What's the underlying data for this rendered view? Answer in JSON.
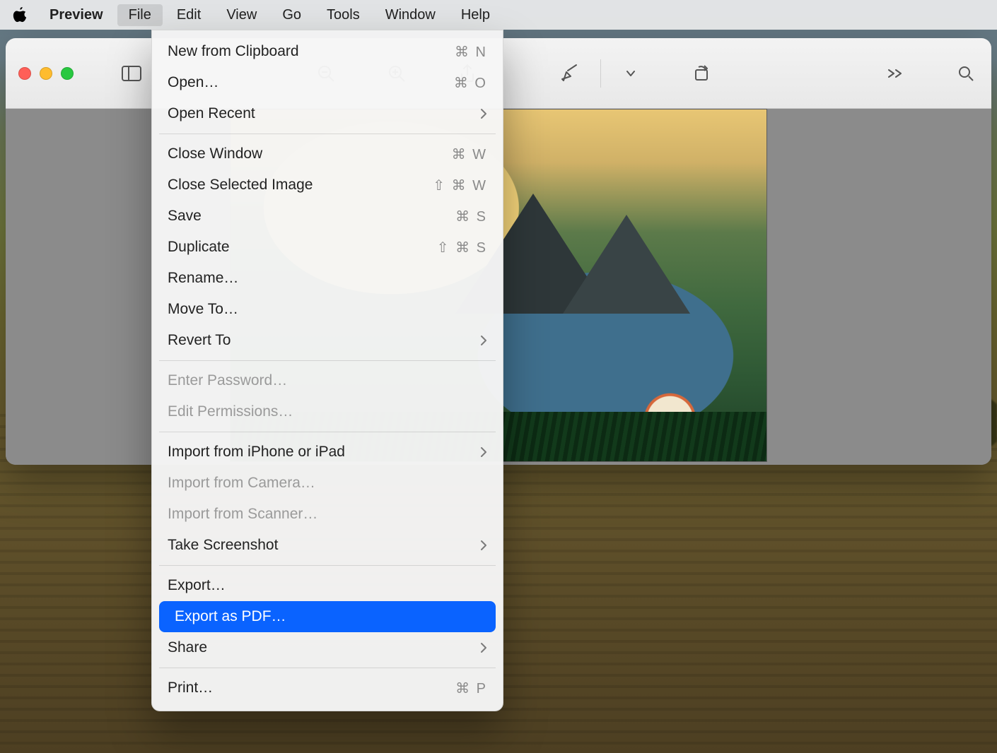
{
  "menubar": {
    "app": "Preview",
    "items": [
      "File",
      "Edit",
      "View",
      "Go",
      "Tools",
      "Window",
      "Help"
    ],
    "active_index": 0
  },
  "toolbar": {
    "icons": [
      {
        "name": "sidebar-icon"
      },
      {
        "name": "zoom-out-icon"
      },
      {
        "name": "zoom-in-icon"
      },
      {
        "name": "share-icon"
      },
      {
        "name": "markup-icon"
      },
      {
        "name": "chevron-down-icon"
      },
      {
        "name": "rotate-icon"
      },
      {
        "name": "more-icon"
      },
      {
        "name": "search-icon"
      }
    ]
  },
  "file_menu": {
    "groups": [
      [
        {
          "label": "New from Clipboard",
          "shortcut": "⌘ N"
        },
        {
          "label": "Open…",
          "shortcut": "⌘ O"
        },
        {
          "label": "Open Recent",
          "submenu": true
        }
      ],
      [
        {
          "label": "Close Window",
          "shortcut": "⌘ W"
        },
        {
          "label": "Close Selected Image",
          "shortcut": "⇧ ⌘ W"
        },
        {
          "label": "Save",
          "shortcut": "⌘ S"
        },
        {
          "label": "Duplicate",
          "shortcut": "⇧ ⌘ S"
        },
        {
          "label": "Rename…"
        },
        {
          "label": "Move To…"
        },
        {
          "label": "Revert To",
          "submenu": true
        }
      ],
      [
        {
          "label": "Enter Password…",
          "disabled": true
        },
        {
          "label": "Edit Permissions…",
          "disabled": true
        }
      ],
      [
        {
          "label": "Import from iPhone or iPad",
          "submenu": true
        },
        {
          "label": "Import from Camera…",
          "disabled": true
        },
        {
          "label": "Import from Scanner…",
          "disabled": true
        },
        {
          "label": "Take Screenshot",
          "submenu": true
        }
      ],
      [
        {
          "label": "Export…"
        },
        {
          "label": "Export as PDF…",
          "selected": true
        },
        {
          "label": "Share",
          "submenu": true
        }
      ],
      [
        {
          "label": "Print…",
          "shortcut": "⌘ P"
        }
      ]
    ]
  }
}
